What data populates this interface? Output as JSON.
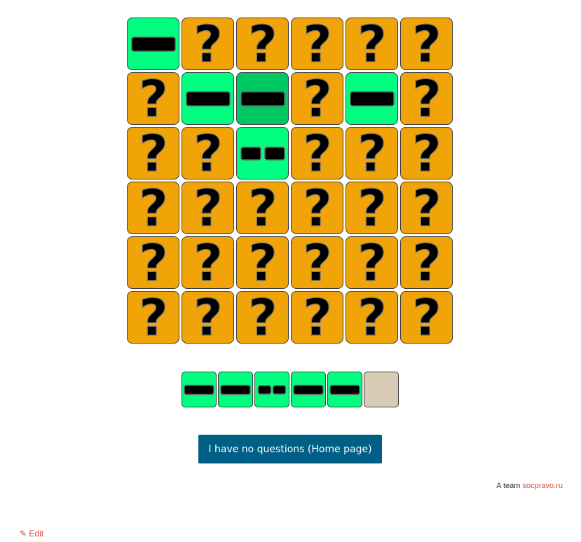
{
  "board": {
    "rows": [
      [
        "long",
        "hidden",
        "hidden",
        "hidden",
        "hidden",
        "hidden"
      ],
      [
        "hidden",
        "long",
        "selected",
        "hidden",
        "long",
        "hidden"
      ],
      [
        "hidden",
        "hidden",
        "short",
        "hidden",
        "hidden",
        "hidden"
      ],
      [
        "hidden",
        "hidden",
        "hidden",
        "hidden",
        "hidden",
        "hidden"
      ],
      [
        "hidden",
        "hidden",
        "hidden",
        "hidden",
        "hidden",
        "hidden"
      ],
      [
        "hidden",
        "hidden",
        "hidden",
        "hidden",
        "hidden",
        "hidden"
      ]
    ],
    "hidden_symbol": "?"
  },
  "sequence": [
    "long",
    "long",
    "short",
    "long",
    "long",
    "empty"
  ],
  "home_button_label": "I have no questions (Home page)",
  "credit": {
    "prefix": "A team ",
    "link_text": "socpravo.ru"
  },
  "edit_link_label": "Edit",
  "colors": {
    "hidden_tile": "#f0a408",
    "revealed_tile": "#00ff80",
    "selected_tile": "#00c864",
    "empty_slot": "#d8ccb6",
    "button": "#005f86",
    "link": "#e0463a"
  }
}
